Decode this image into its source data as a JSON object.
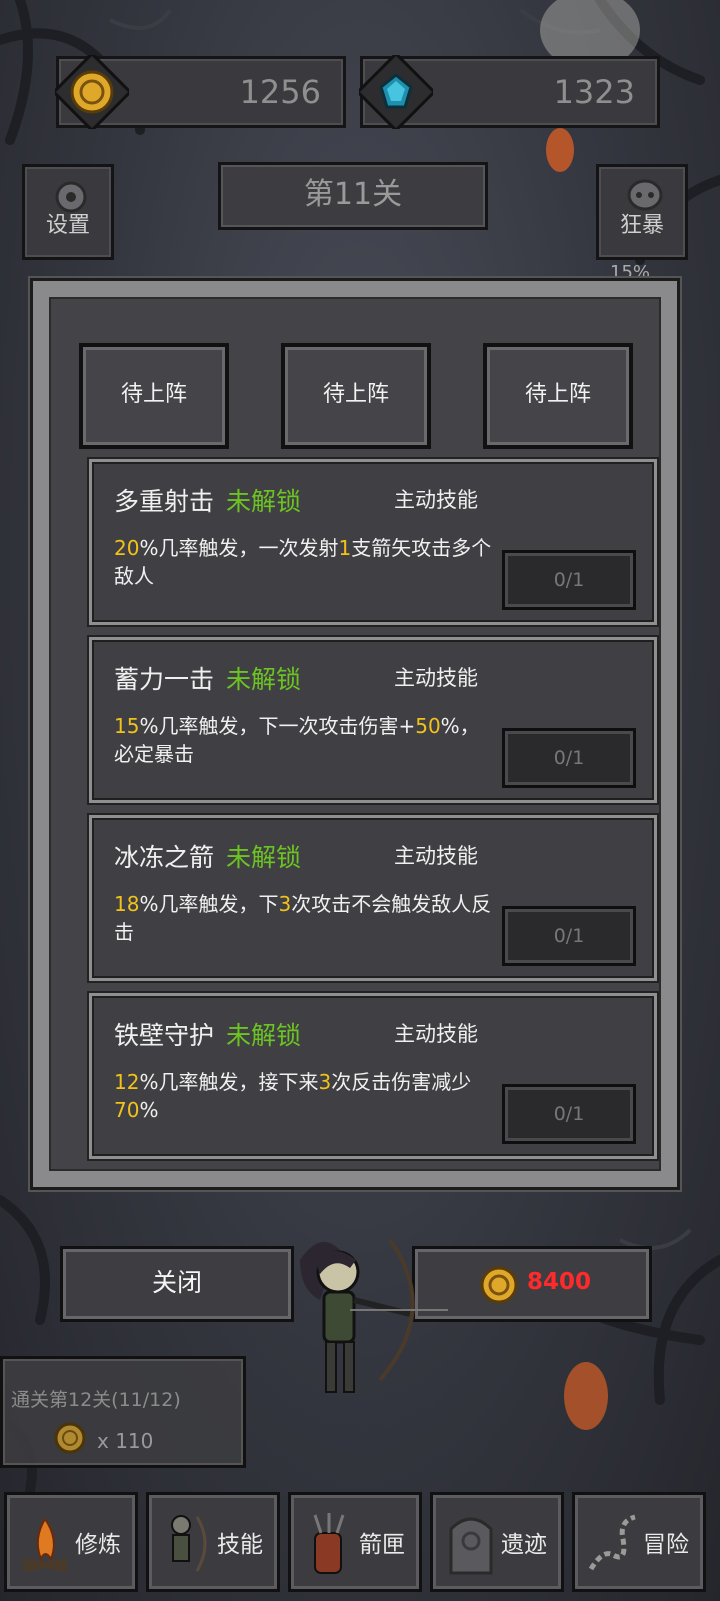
{
  "currency": {
    "gold": "1256",
    "gem": "1323"
  },
  "level_title": "第11关",
  "settings_label": "设置",
  "rage_label": "狂暴",
  "rage_percent": "15%",
  "slots": [
    "待上阵",
    "待上阵",
    "待上阵"
  ],
  "skills": [
    {
      "name": "多重射击",
      "status": "未解锁",
      "type": "主动技能",
      "desc_parts": [
        {
          "text": "20",
          "hl": true
        },
        {
          "text": "%几率触发，一次发射",
          "hl": false
        },
        {
          "text": "1",
          "hl": true
        },
        {
          "text": "支箭矢攻击多个敌人",
          "hl": false
        }
      ],
      "progress": "0/1"
    },
    {
      "name": "蓄力一击",
      "status": "未解锁",
      "type": "主动技能",
      "desc_parts": [
        {
          "text": "15",
          "hl": true
        },
        {
          "text": "%几率触发，下一次攻击伤害+",
          "hl": false
        },
        {
          "text": "50",
          "hl": true
        },
        {
          "text": "%，必定暴击",
          "hl": false
        }
      ],
      "progress": "0/1"
    },
    {
      "name": "冰冻之箭",
      "status": "未解锁",
      "type": "主动技能",
      "desc_parts": [
        {
          "text": "18",
          "hl": true
        },
        {
          "text": "%几率触发，下",
          "hl": false
        },
        {
          "text": "3",
          "hl": true
        },
        {
          "text": "次攻击不会触发敌人反击",
          "hl": false
        }
      ],
      "progress": "0/1"
    },
    {
      "name": "铁壁守护",
      "status": "未解锁",
      "type": "主动技能",
      "desc_parts": [
        {
          "text": "12",
          "hl": true
        },
        {
          "text": "%几率触发，接下来",
          "hl": false
        },
        {
          "text": "3",
          "hl": true
        },
        {
          "text": "次反击伤害减少",
          "hl": false
        },
        {
          "text": "70",
          "hl": true
        },
        {
          "text": "%",
          "hl": false
        }
      ],
      "progress": "0/1"
    }
  ],
  "close_label": "关闭",
  "buy_cost": "8400",
  "quest": {
    "title": "通关第12关(11/12)",
    "reward": "x 110"
  },
  "nav": [
    {
      "label": "修炼",
      "icon": "campfire-icon"
    },
    {
      "label": "技能",
      "icon": "archer-icon"
    },
    {
      "label": "箭匣",
      "icon": "quiver-icon"
    },
    {
      "label": "遗迹",
      "icon": "ruin-stone-icon"
    },
    {
      "label": "冒险",
      "icon": "map-path-icon"
    }
  ],
  "colors": {
    "locked_green": "#6cc422",
    "highlight_yellow": "#f0c21a",
    "cost_red": "#ff2a2a"
  }
}
